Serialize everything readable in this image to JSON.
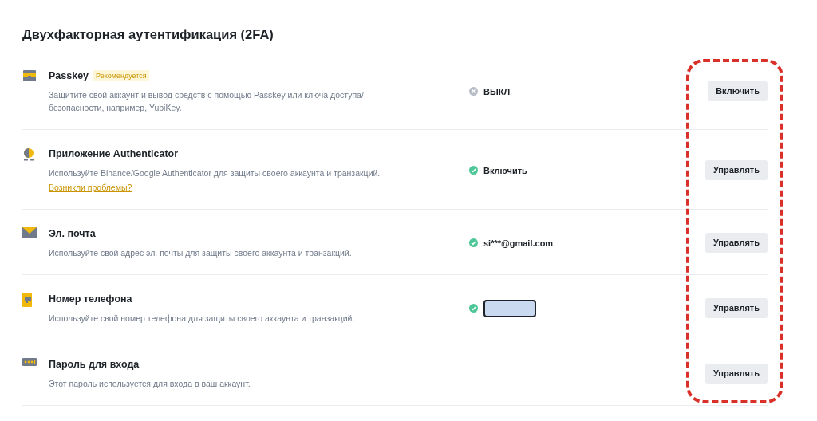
{
  "title": "Двухфакторная аутентификация (2FA)",
  "methods": [
    {
      "kind": "passkey",
      "name": "Passkey",
      "badge": "Рекомендуется",
      "description": "Защитите свой аккаунт и вывод средств с помощью Passkey или ключа доступа/безопасности, например, YubiKey.",
      "status": {
        "on": false,
        "text": "ВЫКЛ"
      },
      "button": "Включить"
    },
    {
      "kind": "authenticator",
      "name": "Приложение Authenticator",
      "description": "Используйте Binance/Google Authenticator для защиты своего аккаунта и транзакций.",
      "link": "Возникли проблемы?",
      "status": {
        "on": true,
        "text": "Включить"
      },
      "button": "Управлять"
    },
    {
      "kind": "email",
      "name": "Эл. почта",
      "description": "Используйте свой адрес эл. почты для защиты своего аккаунта и транзакций.",
      "status": {
        "on": true,
        "text": "si***@gmail.com"
      },
      "button": "Управлять"
    },
    {
      "kind": "phone",
      "name": "Номер телефона",
      "description": "Используйте свой номер телефона для защиты своего аккаунта и транзакций.",
      "status": {
        "on": true,
        "redacted": true
      },
      "button": "Управлять"
    },
    {
      "kind": "password",
      "name": "Пароль для входа",
      "description": "Этот пароль используется для входа в ваш аккаунт.",
      "button": "Управлять"
    }
  ],
  "annotation": {
    "kind": "dashed-outline"
  }
}
